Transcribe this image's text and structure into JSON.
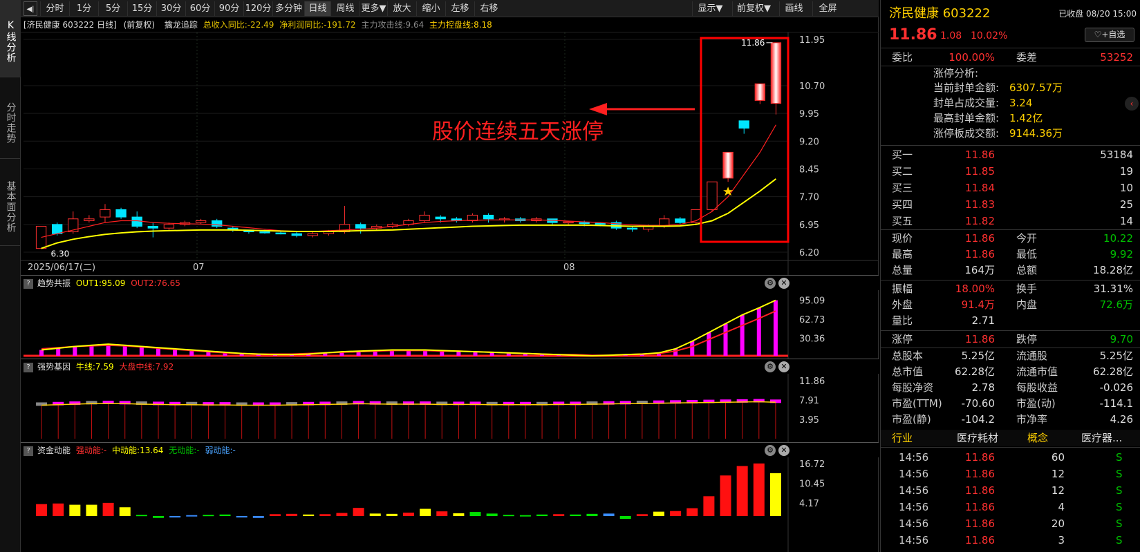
{
  "left_tabs": [
    "K线分析",
    "分时走势",
    "基本面分析"
  ],
  "toolbar": {
    "back_icon": "back-arrow-icon",
    "periods": [
      "分时",
      "1分",
      "5分",
      "15分",
      "30分",
      "60分",
      "90分",
      "120分",
      "多分钟",
      "日线",
      "周线",
      "更多▼",
      "放大",
      "缩小",
      "左移",
      "右移"
    ],
    "selected": "日线",
    "right": [
      "显示▼",
      "前复权▼",
      "画线",
      "全屏"
    ]
  },
  "info": {
    "title": "[济民健康 603222 日线]",
    "adjust": "(前复权)",
    "indicator": "擒龙追踪",
    "rev": "总收入同比:-22.49",
    "profit": "净利润同比:-191.72",
    "attack": "主力攻击线:9.64",
    "control": "主力控盘线:8.18"
  },
  "annotation": "股价连续五天涨停",
  "main_axis": [
    "11.95",
    "10.70",
    "9.95",
    "9.20",
    "8.45",
    "7.70",
    "6.95",
    "6.20"
  ],
  "high_label": "11.86",
  "low_label": "6.30",
  "date_labels": [
    "2025/06/17(二)",
    "07",
    "08"
  ],
  "panels": [
    {
      "name": "趋势共振",
      "v1": "OUT1:95.09",
      "v2": "OUT2:76.65",
      "axis": [
        "95.09",
        "62.73",
        "30.36"
      ]
    },
    {
      "name": "强势基因",
      "v1": "牛线:7.59",
      "v2": "大盘中线:7.92",
      "axis": [
        "11.86",
        "7.91",
        "3.95"
      ]
    },
    {
      "name": "资金动能",
      "v1": "强动能:-",
      "v2": "中动能:13.64",
      "v3": "无动能:-",
      "v4": "弱动能:-",
      "axis": [
        "16.72",
        "10.45",
        "4.17"
      ]
    }
  ],
  "colors": {
    "up": "#ff3030",
    "down": "#00e5ff",
    "ma1": "#ff2020",
    "ma2": "#ffff00",
    "magenta": "#ff00ff",
    "highlight": "#ff0000"
  },
  "stock": {
    "name": "济民健康",
    "code": "603222",
    "status": "已收盘 08/20 15:00",
    "price": "11.86",
    "change": "1.08",
    "pct": "10.02%",
    "fav": "♡+自选",
    "wb_label": "委比",
    "wb": "100.00%",
    "wc_label": "委差",
    "wc": "53252"
  },
  "limit": {
    "title": "涨停分析:",
    "rows": [
      {
        "k": "当前封单金额:",
        "v": "6307.57万"
      },
      {
        "k": "封单占成交量:",
        "v": "3.24"
      },
      {
        "k": "最高封单金额:",
        "v": "1.42亿"
      },
      {
        "k": "涨停板成交额:",
        "v": "9144.36万"
      }
    ]
  },
  "bids": [
    {
      "label": "买一",
      "price": "11.86",
      "vol": "53184"
    },
    {
      "label": "买二",
      "price": "11.85",
      "vol": "19"
    },
    {
      "label": "买三",
      "price": "11.84",
      "vol": "10"
    },
    {
      "label": "买四",
      "price": "11.83",
      "vol": "25"
    },
    {
      "label": "买五",
      "price": "11.82",
      "vol": "14"
    }
  ],
  "quote": [
    {
      "k1": "现价",
      "v1": "11.86",
      "c1": "red",
      "k2": "今开",
      "v2": "10.22",
      "c2": "green"
    },
    {
      "k1": "最高",
      "v1": "11.86",
      "c1": "red",
      "k2": "最低",
      "v2": "9.92",
      "c2": "green"
    },
    {
      "k1": "总量",
      "v1": "164万",
      "c1": "white",
      "k2": "总额",
      "v2": "18.28亿",
      "c2": "white"
    }
  ],
  "quote2": [
    {
      "k1": "振幅",
      "v1": "18.00%",
      "c1": "red",
      "k2": "换手",
      "v2": "31.31%",
      "c2": "white"
    },
    {
      "k1": "外盘",
      "v1": "91.4万",
      "c1": "red",
      "k2": "内盘",
      "v2": "72.6万",
      "c2": "green"
    },
    {
      "k1": "量比",
      "v1": "2.71",
      "c1": "white",
      "k2": "",
      "v2": "",
      "c2": "white"
    }
  ],
  "limits": {
    "k1": "涨停",
    "v1": "11.86",
    "k2": "跌停",
    "v2": "9.70"
  },
  "fund": [
    {
      "k1": "总股本",
      "v1": "5.25亿",
      "k2": "流通股",
      "v2": "5.25亿"
    },
    {
      "k1": "总市值",
      "v1": "62.28亿",
      "k2": "流通市值",
      "v2": "62.28亿"
    },
    {
      "k1": "每股净资",
      "v1": "2.78",
      "k2": "每股收益",
      "v2": "-0.026"
    },
    {
      "k1": "市盈(TTM)",
      "v1": "-70.60",
      "k2": "市盈(动)",
      "v2": "-114.1"
    },
    {
      "k1": "市盈(静)",
      "v1": "-104.2",
      "k2": "市净率",
      "v2": "4.26"
    }
  ],
  "industry": {
    "k1": "行业",
    "v1": "医疗耗材",
    "k2": "概念",
    "v2": "医疗器..."
  },
  "ticks": [
    {
      "t": "14:56",
      "p": "11.86",
      "v": "60",
      "s": "S"
    },
    {
      "t": "14:56",
      "p": "11.86",
      "v": "12",
      "s": "S"
    },
    {
      "t": "14:56",
      "p": "11.86",
      "v": "12",
      "s": "S"
    },
    {
      "t": "14:56",
      "p": "11.86",
      "v": "4",
      "s": "S"
    },
    {
      "t": "14:56",
      "p": "11.86",
      "v": "20",
      "s": "S"
    },
    {
      "t": "14:56",
      "p": "11.86",
      "v": "3",
      "s": "S"
    }
  ],
  "chart_data": {
    "type": "candlestick",
    "ylim": [
      6.2,
      11.95
    ],
    "candles": [
      [
        6.3,
        6.9,
        6.3,
        6.9
      ],
      [
        6.95,
        6.7,
        6.65,
        7.0
      ],
      [
        6.75,
        7.1,
        6.7,
        7.3
      ],
      [
        7.05,
        7.1,
        7.0,
        7.2
      ],
      [
        7.15,
        7.35,
        7.0,
        7.5
      ],
      [
        7.35,
        7.15,
        7.1,
        7.4
      ],
      [
        7.15,
        6.9,
        6.85,
        7.3
      ],
      [
        6.9,
        6.85,
        6.6,
        7.0
      ],
      [
        6.85,
        6.95,
        6.8,
        7.0
      ],
      [
        6.95,
        7.0,
        6.9,
        7.05
      ],
      [
        7.0,
        7.05,
        6.95,
        7.1
      ],
      [
        7.05,
        6.9,
        6.85,
        7.1
      ],
      [
        6.85,
        6.8,
        6.75,
        6.9
      ],
      [
        6.8,
        6.75,
        6.7,
        6.8
      ],
      [
        6.75,
        6.72,
        6.7,
        6.8
      ],
      [
        6.72,
        6.7,
        6.68,
        6.78
      ],
      [
        6.7,
        6.65,
        6.6,
        6.75
      ],
      [
        6.65,
        6.7,
        6.6,
        6.75
      ],
      [
        6.7,
        6.75,
        6.65,
        6.8
      ],
      [
        6.75,
        6.95,
        6.7,
        7.45
      ],
      [
        6.95,
        6.85,
        6.7,
        7.0
      ],
      [
        6.85,
        6.9,
        6.8,
        6.95
      ],
      [
        6.9,
        6.95,
        6.85,
        7.0
      ],
      [
        6.95,
        7.05,
        6.9,
        7.1
      ],
      [
        7.05,
        7.2,
        7.0,
        7.3
      ],
      [
        7.15,
        7.1,
        7.0,
        7.2
      ],
      [
        7.1,
        7.05,
        7.0,
        7.15
      ],
      [
        7.05,
        7.2,
        7.0,
        7.25
      ],
      [
        7.2,
        7.1,
        7.0,
        7.25
      ],
      [
        7.1,
        7.1,
        7.0,
        7.15
      ],
      [
        7.1,
        7.05,
        7.0,
        7.15
      ],
      [
        7.05,
        7.1,
        7.0,
        7.15
      ],
      [
        7.1,
        7.0,
        6.95,
        7.1
      ],
      [
        7.0,
        7.02,
        6.95,
        7.05
      ],
      [
        7.0,
        6.98,
        6.9,
        7.05
      ],
      [
        6.98,
        6.96,
        6.9,
        7.0
      ],
      [
        7.0,
        6.85,
        6.8,
        7.05
      ],
      [
        6.85,
        6.82,
        6.75,
        6.9
      ],
      [
        6.82,
        6.9,
        6.75,
        6.95
      ],
      [
        6.9,
        7.1,
        6.85,
        7.2
      ],
      [
        7.1,
        7.0,
        6.95,
        7.15
      ],
      [
        7.0,
        7.35,
        6.95,
        7.35
      ],
      [
        7.35,
        8.1,
        7.3,
        8.1
      ],
      [
        8.2,
        8.9,
        8.1,
        8.9
      ],
      [
        9.75,
        9.55,
        9.4,
        9.75
      ],
      [
        10.3,
        10.75,
        10.2,
        10.75
      ],
      [
        10.22,
        11.86,
        9.92,
        11.86
      ]
    ],
    "ma1": [
      6.6,
      6.7,
      6.8,
      6.9,
      7.0,
      7.05,
      7.05,
      7.0,
      6.98,
      6.97,
      6.96,
      6.94,
      6.9,
      6.86,
      6.82,
      6.78,
      6.76,
      6.76,
      6.78,
      6.8,
      6.82,
      6.85,
      6.9,
      6.95,
      7.0,
      7.03,
      7.05,
      7.06,
      7.07,
      7.07,
      7.07,
      7.07,
      7.06,
      7.04,
      7.02,
      7.0,
      6.97,
      6.94,
      6.92,
      6.92,
      6.95,
      7.05,
      7.3,
      7.7,
      8.3,
      8.9,
      9.64
    ],
    "ma2": [
      6.3,
      6.45,
      6.55,
      6.62,
      6.68,
      6.72,
      6.75,
      6.77,
      6.78,
      6.79,
      6.8,
      6.8,
      6.8,
      6.79,
      6.78,
      6.77,
      6.76,
      6.76,
      6.76,
      6.77,
      6.78,
      6.79,
      6.8,
      6.82,
      6.84,
      6.86,
      6.88,
      6.9,
      6.91,
      6.92,
      6.93,
      6.93,
      6.93,
      6.93,
      6.93,
      6.92,
      6.91,
      6.9,
      6.9,
      6.9,
      6.91,
      6.95,
      7.05,
      7.25,
      7.55,
      7.85,
      8.18
    ],
    "trend": {
      "ylim": [
        0,
        110
      ],
      "out1": [
        10,
        13,
        16,
        18,
        20,
        18,
        16,
        14,
        12,
        10,
        8,
        6,
        4,
        3,
        2,
        2,
        3,
        5,
        7,
        8,
        9,
        10,
        10,
        10,
        9,
        8,
        7,
        6,
        5,
        4,
        3,
        2,
        1,
        0,
        1,
        2,
        3,
        5,
        12,
        25,
        40,
        55,
        70,
        82,
        95.09
      ],
      "out2": [
        12,
        14,
        16,
        17,
        18,
        17,
        15,
        13,
        11,
        9,
        7,
        5,
        4,
        3,
        3,
        3,
        4,
        5,
        6,
        7,
        8,
        9,
        9,
        9,
        8,
        8,
        7,
        6,
        5,
        4,
        3,
        2,
        2,
        1,
        1,
        2,
        3,
        4,
        8,
        16,
        28,
        40,
        52,
        64,
        76.65
      ]
    },
    "strong": {
      "ylim": [
        0,
        13
      ],
      "bull": [
        7.0,
        7.1,
        7.2,
        7.3,
        7.35,
        7.3,
        7.2,
        7.15,
        7.1,
        7.1,
        7.05,
        7.05,
        7.0,
        7.0,
        7.0,
        7.05,
        7.1,
        7.15,
        7.2,
        7.3,
        7.25,
        7.2,
        7.2,
        7.2,
        7.15,
        7.15,
        7.15,
        7.1,
        7.1,
        7.1,
        7.1,
        7.15,
        7.15,
        7.2,
        7.25,
        7.3,
        7.35,
        7.4,
        7.45,
        7.5,
        7.55,
        7.6,
        7.65,
        7.7,
        7.59
      ],
      "market": 7.92
    },
    "money": {
      "ylim": [
        0,
        18
      ],
      "values": [
        3.8,
        4.0,
        3.6,
        3.6,
        4.2,
        2.8,
        0.4,
        -0.6,
        -0.3,
        0.3,
        0.4,
        0.5,
        -0.3,
        -0.6,
        0.6,
        0.7,
        0.5,
        0.6,
        1.0,
        2.6,
        0.8,
        0.7,
        1.1,
        2.3,
        1.5,
        0.9,
        1.3,
        0.8,
        0.4,
        0.3,
        0.5,
        0.6,
        0.5,
        0.7,
        0.8,
        -0.9,
        0.6,
        1.4,
        1.6,
        2.5,
        6.3,
        12.9,
        15.9,
        16.72,
        13.64
      ],
      "colors": [
        "r",
        "r",
        "y",
        "y",
        "r",
        "y",
        "g",
        "g",
        "b",
        "b",
        "g",
        "g",
        "b",
        "b",
        "r",
        "r",
        "y",
        "r",
        "r",
        "r",
        "y",
        "y",
        "r",
        "y",
        "r",
        "y",
        "g",
        "g",
        "g",
        "g",
        "g",
        "r",
        "g",
        "g",
        "b",
        "g",
        "r",
        "y",
        "r",
        "r",
        "r",
        "r",
        "r",
        "r",
        "y"
      ]
    }
  }
}
